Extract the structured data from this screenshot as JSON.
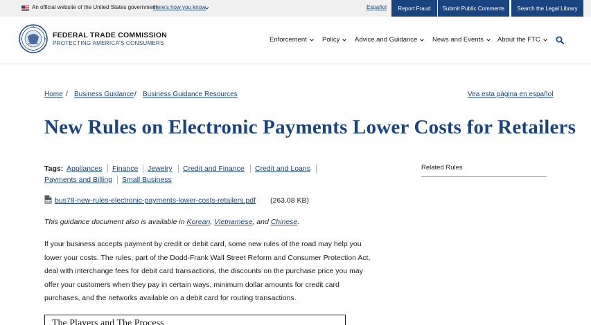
{
  "gov_banner": {
    "text": "An official website of the United States government",
    "link": "Here's how you know"
  },
  "utility_nav": {
    "espanol": "Español",
    "report_fraud": "Report Fraud",
    "submit_comments": "Submit Public Comments",
    "legal_library": "Search the Legal Library"
  },
  "header": {
    "agency_name": "FEDERAL TRADE COMMISSION",
    "tagline": "PROTECTING AMERICA'S CONSUMERS"
  },
  "main_nav": [
    {
      "label": "Enforcement"
    },
    {
      "label": "Policy"
    },
    {
      "label": "Advice and Guidance"
    },
    {
      "label": "News and Events"
    },
    {
      "label": "About the FTC"
    }
  ],
  "breadcrumb": {
    "items": [
      "Home",
      "Business Guidance",
      "Business Guidance Resources"
    ],
    "separator": "/"
  },
  "language_link": "Vea esta página en español",
  "page_title": "New Rules on Electronic Payments Lower Costs for Retailers",
  "tags": {
    "label": "Tags:",
    "items": [
      "Appliances",
      "Finance",
      "Jewelry",
      "Credit and Finance",
      "Credit and Loans",
      "Payments and Billing",
      "Small Business"
    ]
  },
  "related_rules": "Related Rules",
  "pdf": {
    "filename": "bus78-new-rules-electronic-payments-lower-costs-retailers.pdf",
    "size": "(263.08 KB)"
  },
  "availability": {
    "prefix": "This guidance document also is available in",
    "languages": [
      "Korean",
      "Vietnamese",
      "Chinese"
    ],
    "sep1": ",",
    "sep2": ", and",
    "suffix": "."
  },
  "body_lines": [
    "If your business accepts payment by credit or debit card, some new rules of the road may help you",
    "lower your costs. The rules, part of the Dodd-Frank Wall Street Reform and Consumer Protection Act,",
    "deal with interchange fees for debit card transactions, the discounts on the purchase price you may",
    "offer your customers when they pay in certain ways, minimum dollar amounts for credit card",
    "purchases, and the networks available on a debit card for routing transactions."
  ],
  "box_title": "The Players and The Process",
  "colors": {
    "brand_blue": "#1a4480",
    "banner_bg": "#f0f0f0",
    "text": "#1b1b1b"
  },
  "icons": [
    "us-flag-icon",
    "chevron-down-icon",
    "ftc-seal-icon",
    "search-icon",
    "pdf-file-icon"
  ]
}
